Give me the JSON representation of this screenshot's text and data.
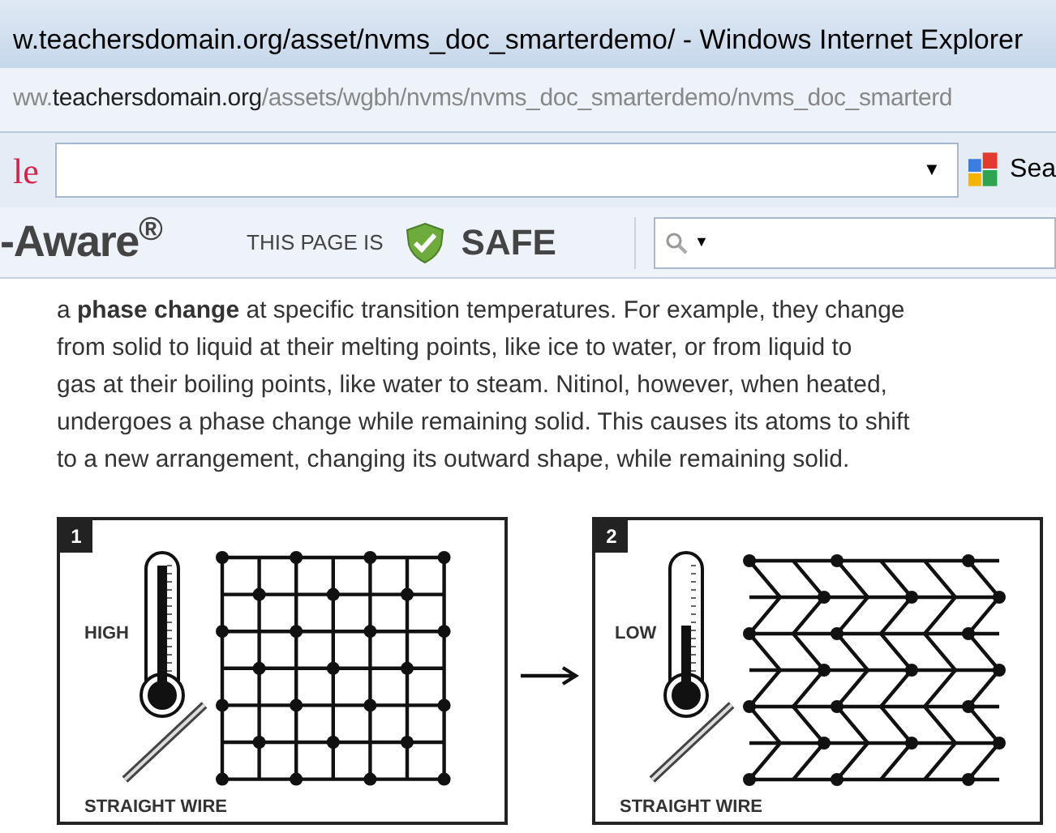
{
  "window": {
    "title": "w.teachersdomain.org/asset/nvms_doc_smarterdemo/ - Windows Internet Explorer"
  },
  "address_bar": {
    "prefix": "ww.",
    "host": "teachersdomain.org",
    "path": "/assets/wgbh/nvms/nvms_doc_smarterdemo/nvms_doc_smarterd"
  },
  "google_toolbar": {
    "logo": "le",
    "dropdown": "▼",
    "search_button": "Sea"
  },
  "safety_toolbar": {
    "brand": "-Aware$^{®}$",
    "status_label": "THIS PAGE IS",
    "status": "SAFE",
    "search_dropdown": "▼"
  },
  "article": {
    "lines": [
      "a **phase change** at specific transition temperatures. For example, they change",
      "from solid to liquid at their melting points, like ice to water, or from liquid to",
      "gas at their boiling points, like water to steam. Nitinol, however, when heated,",
      "undergoes a phase change while remaining solid. This causes its atoms to shift",
      "to a new arrangement, changing its outward shape, while remaining solid."
    ]
  },
  "figures": [
    {
      "number": "1",
      "temperature": "HIGH",
      "level": 1,
      "kind": "square",
      "wire_label": "STRAIGHT WIRE"
    },
    {
      "number": "2",
      "temperature": "LOW",
      "level": 0.5,
      "kind": "chevron",
      "wire_label": "STRAIGHT WIRE"
    }
  ]
}
